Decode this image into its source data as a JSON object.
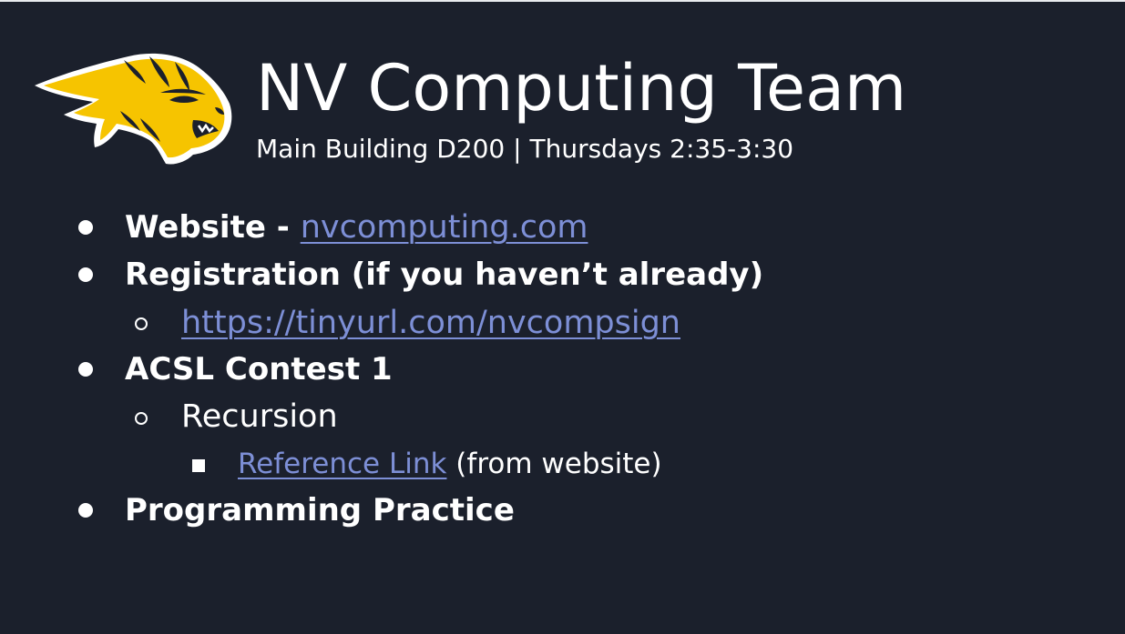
{
  "slide": {
    "title": "NV Computing Team",
    "subtitle": "Main Building D200 | Thursdays 2:35-3:30",
    "logo_icon": "wildcat-mascot-icon",
    "colors": {
      "background": "#1b202c",
      "text": "#ffffff",
      "link": "#7d8fd6",
      "logo_gold": "#f6c400"
    },
    "bullets": {
      "website_label": "Website - ",
      "website_link": "nvcomputing.com",
      "registration_label": "Registration (if you haven’t already)",
      "registration_link": "https://tinyurl.com/nvcompsign",
      "acsl_label": "ACSL Contest 1",
      "recursion_label": "Recursion",
      "reference_link": "Reference Link",
      "reference_note": " (from website)",
      "practice_label": "Programming Practice"
    }
  }
}
